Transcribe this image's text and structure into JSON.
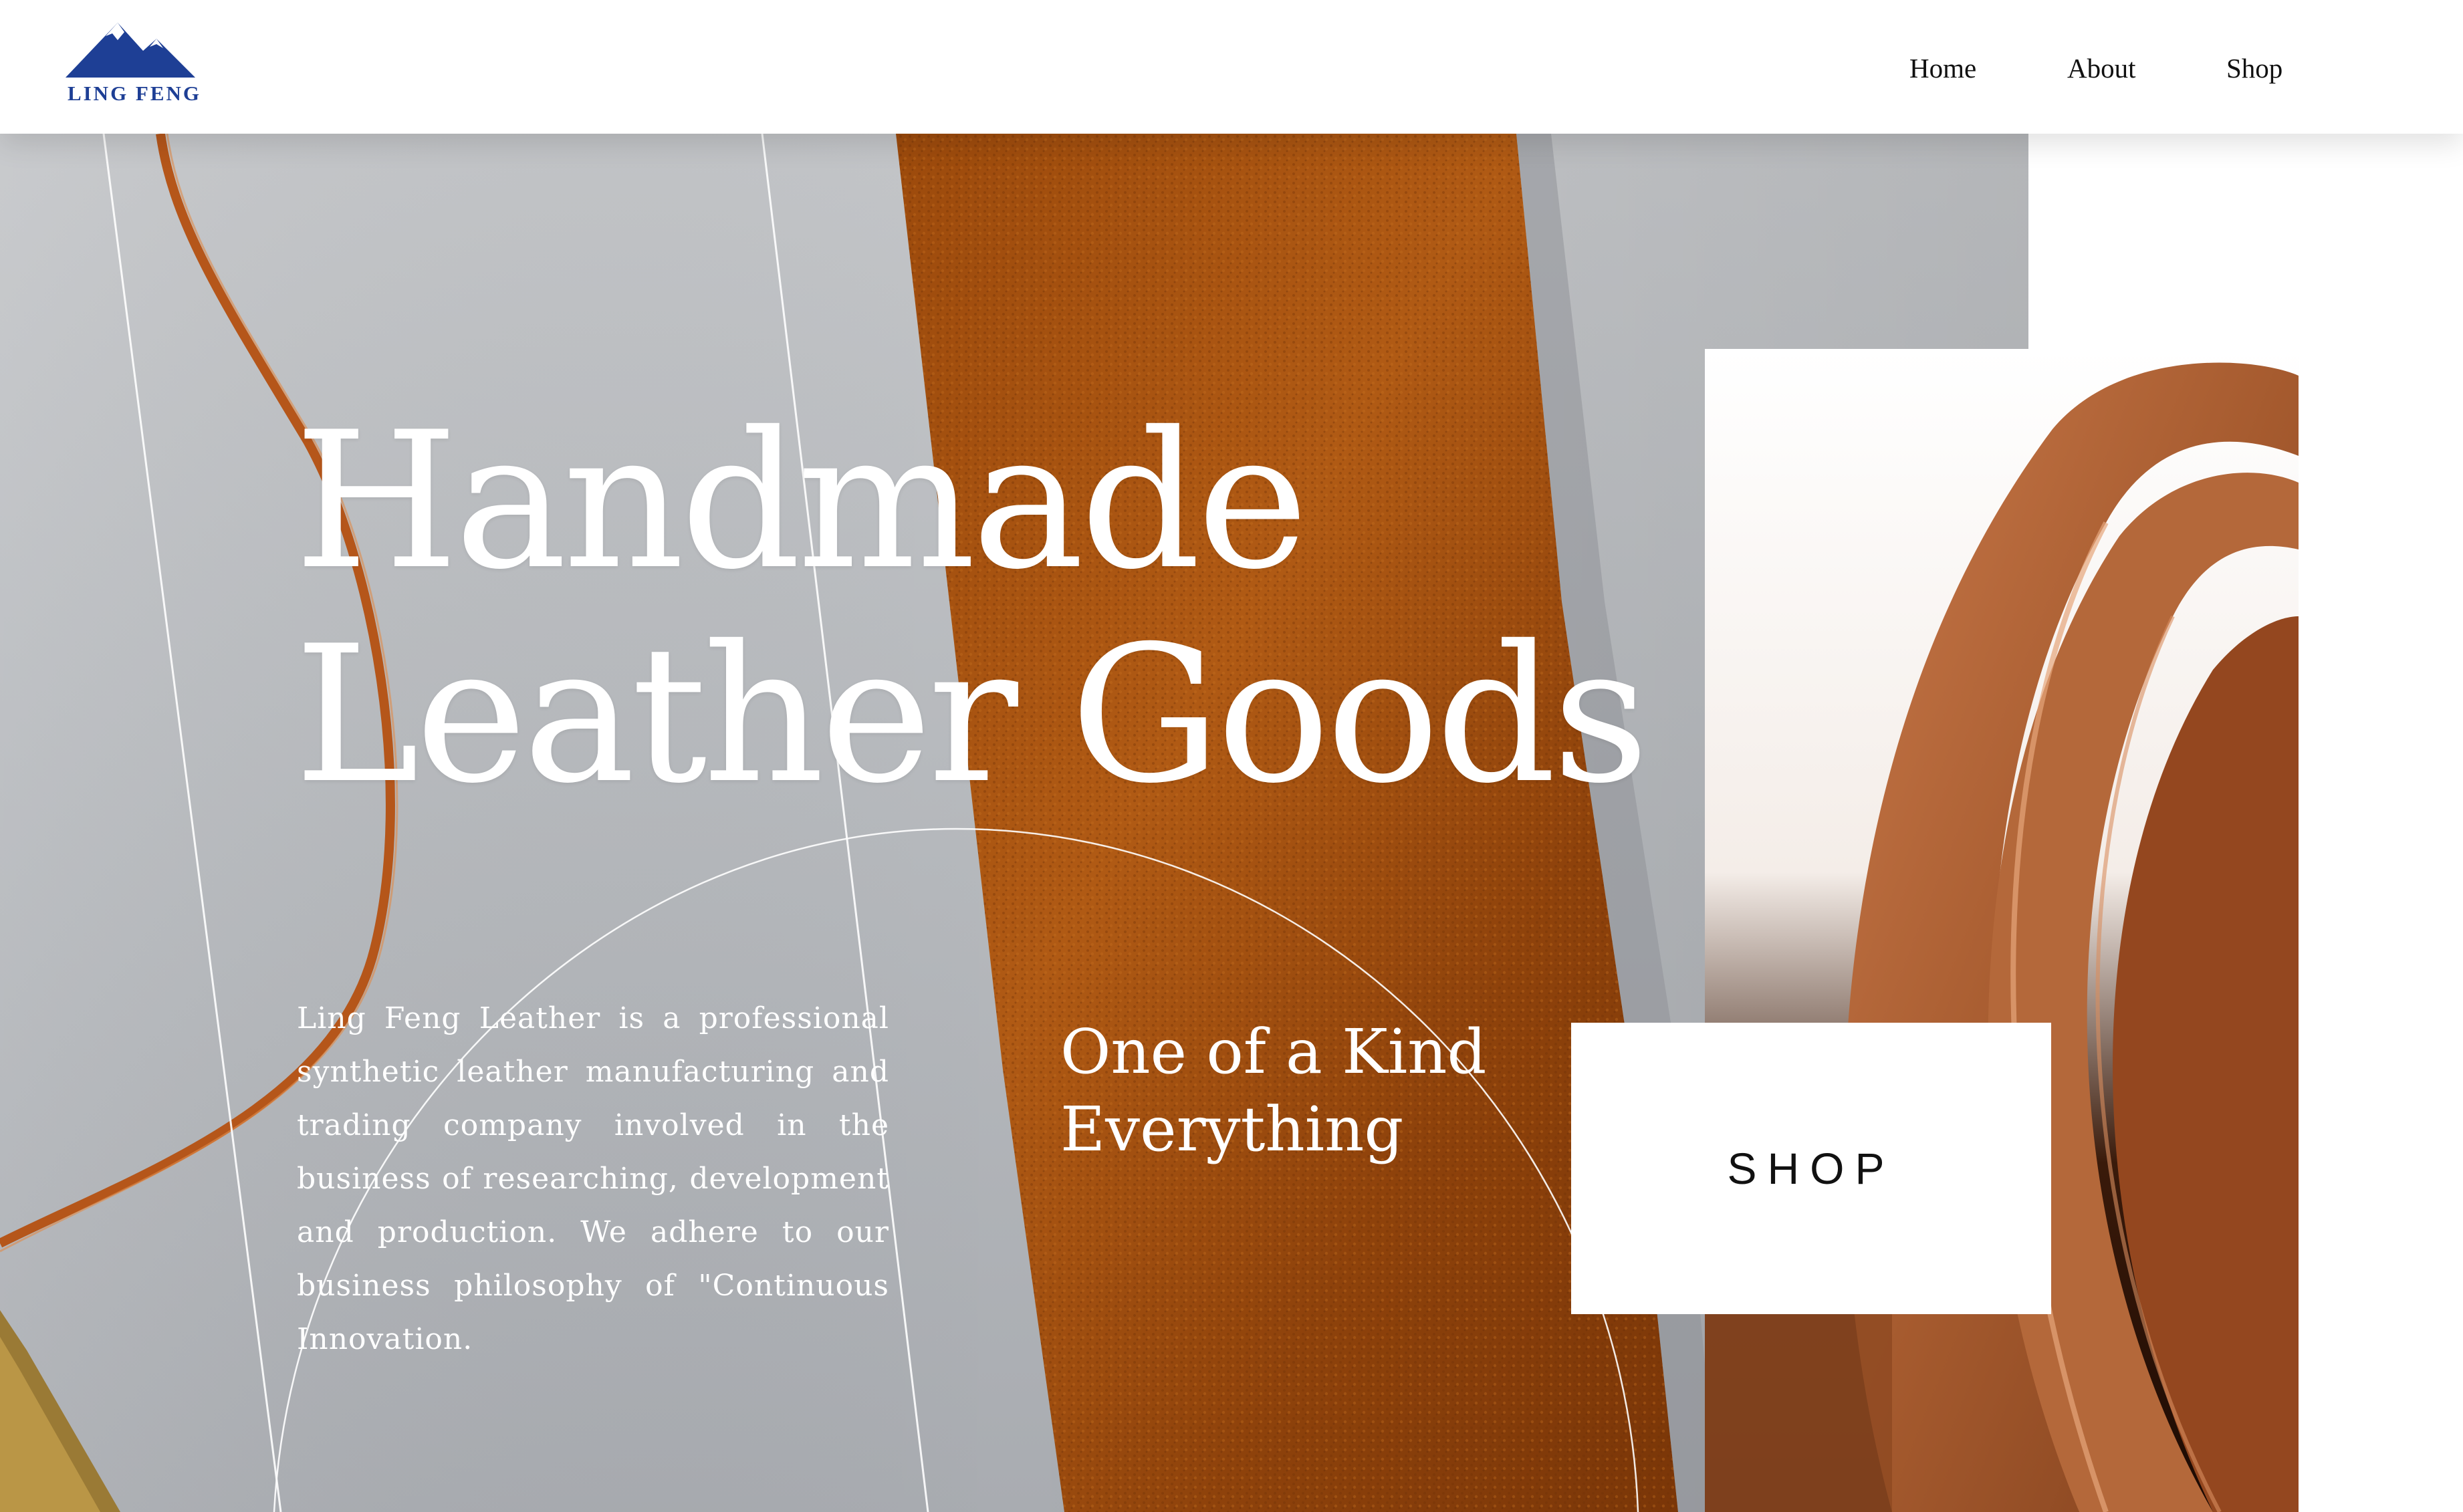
{
  "brand": {
    "name": "LING FENG",
    "logo_icon": "mountain-icon",
    "color": "#1e3f95"
  },
  "nav": {
    "items": [
      {
        "label": "Home"
      },
      {
        "label": "About"
      },
      {
        "label": "Shop"
      }
    ]
  },
  "hero": {
    "title_line1": "Handmade",
    "title_line2": "Leather Goods",
    "description": "Ling Feng Leather is a professional synthetic leather manufacturing and trading company involved in the business of researching, development and production. We adhere to our business philosophy of \"Continuous Innovation.",
    "tagline_line1": "One of a Kind",
    "tagline_line2": "Everything"
  },
  "cta": {
    "shop_label": "SHOP"
  },
  "colors": {
    "leather": "#a3500f",
    "background_gray": "#b8bbbf",
    "text_light": "#ffffff"
  }
}
